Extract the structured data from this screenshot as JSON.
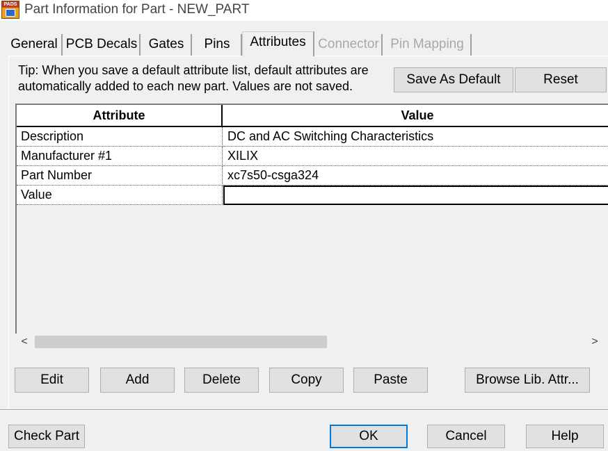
{
  "window": {
    "title": "Part Information for Part - NEW_PART",
    "icon_text": "PADS",
    "icon": "pads-app-icon"
  },
  "tabs": [
    {
      "label": "General",
      "state": "normal"
    },
    {
      "label": "PCB Decals",
      "state": "normal"
    },
    {
      "label": "Gates",
      "state": "normal"
    },
    {
      "label": "Pins",
      "state": "normal"
    },
    {
      "label": "Attributes",
      "state": "active"
    },
    {
      "label": "Connector",
      "state": "disabled"
    },
    {
      "label": "Pin Mapping",
      "state": "disabled"
    }
  ],
  "attributes_tab": {
    "tip_line1": "Tip: When you save a default attribute list, default attributes are",
    "tip_line2": "automatically added to each new part. Values are not saved.",
    "save_as_default_label": "Save As Default",
    "reset_label": "Reset",
    "grid": {
      "columns": [
        "Attribute",
        "Value"
      ],
      "rows": [
        {
          "attribute": "Description",
          "value": "DC and AC Switching Characteristics"
        },
        {
          "attribute": "Manufacturer #1",
          "value": "XILIX"
        },
        {
          "attribute": "Part Number",
          "value": "xc7s50-csga324"
        },
        {
          "attribute": "Value",
          "value": ""
        }
      ]
    },
    "scroll_left": "<",
    "scroll_right": ">",
    "buttons": {
      "edit": "Edit",
      "add": "Add",
      "delete": "Delete",
      "copy": "Copy",
      "paste": "Paste",
      "browse": "Browse Lib. Attr..."
    }
  },
  "footer": {
    "check_part": "Check Part",
    "ok": "OK",
    "cancel": "Cancel",
    "help": "Help"
  },
  "colors": {
    "dialog_bg": "#f0f0f0",
    "button_bg": "#e1e1e1",
    "default_button_border": "#0078d7",
    "disabled_text": "#a8a8a8"
  }
}
